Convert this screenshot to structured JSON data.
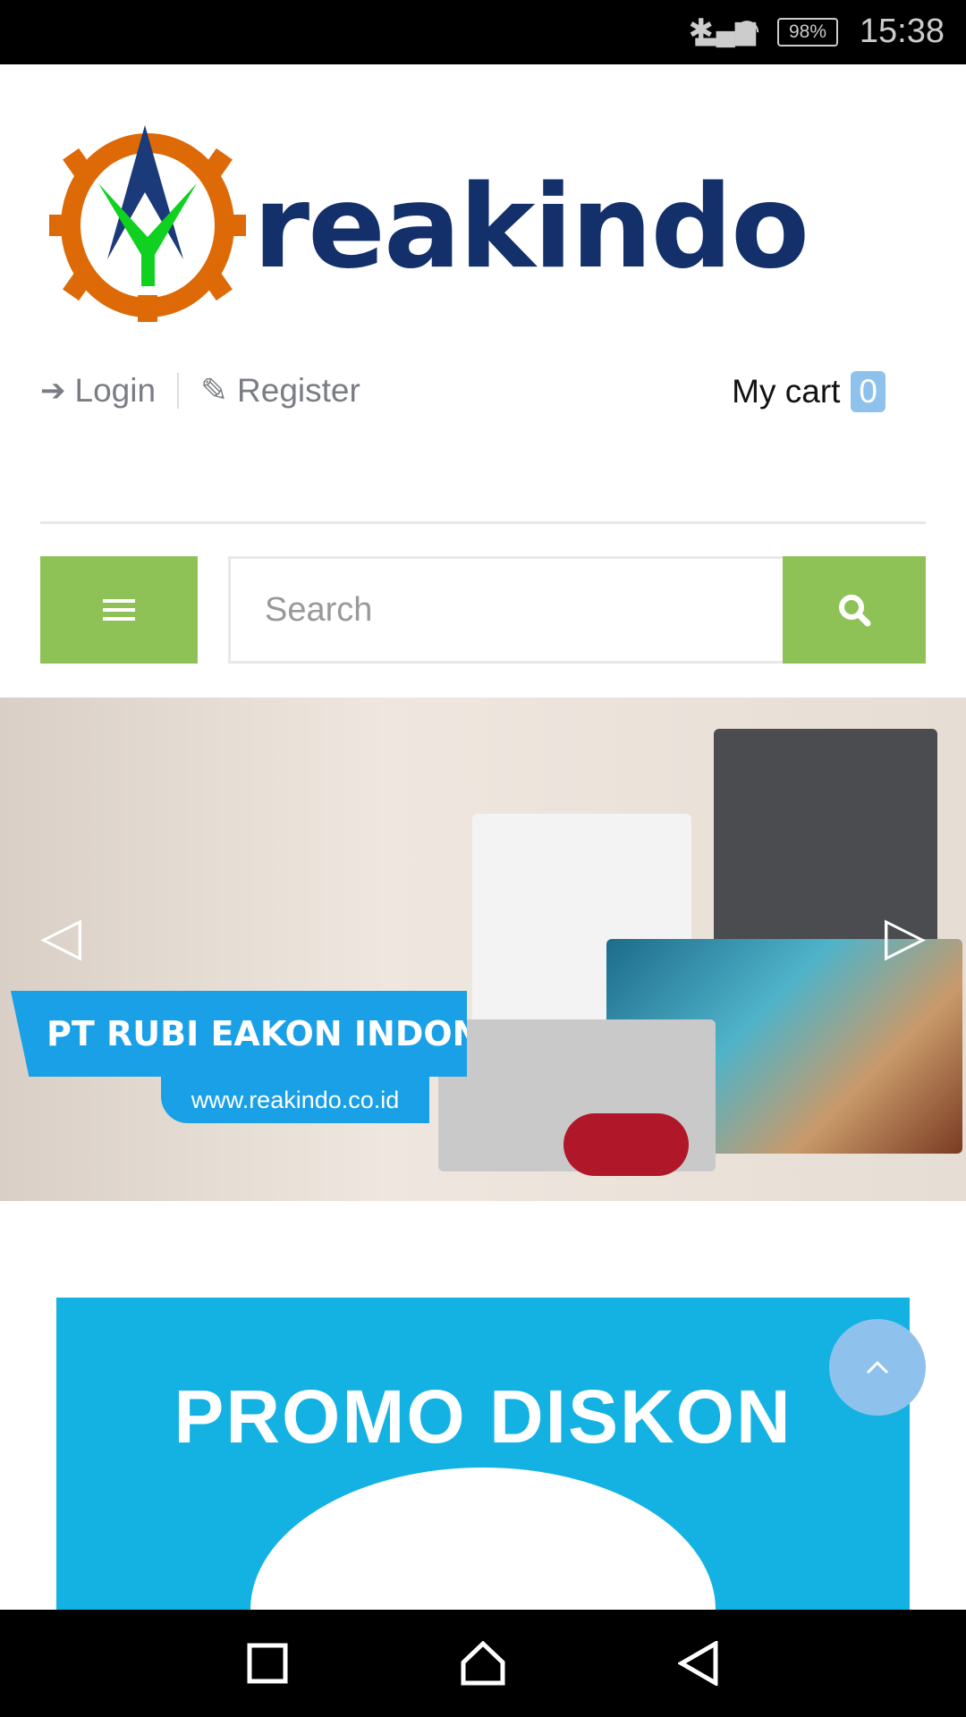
{
  "status_bar": {
    "time": "15:38",
    "battery": "98%",
    "icons": [
      "bluetooth-icon",
      "wifi-icon",
      "signal-icon",
      "battery-icon"
    ]
  },
  "brand": {
    "name": "reakindo"
  },
  "header": {
    "login": "Login",
    "register": "Register",
    "cart_label": "My cart",
    "cart_count": "0"
  },
  "search": {
    "placeholder": "Search",
    "value": ""
  },
  "banner": {
    "headline": "PT RUBI EAKON INDONESIA",
    "url": "www.reakindo.co.id"
  },
  "promo": {
    "title": "PROMO DISKON"
  },
  "colors": {
    "accent": "#8fc256",
    "brand": "#14306b",
    "badge": "#8ec2ec",
    "promo": "#14b2e3"
  }
}
